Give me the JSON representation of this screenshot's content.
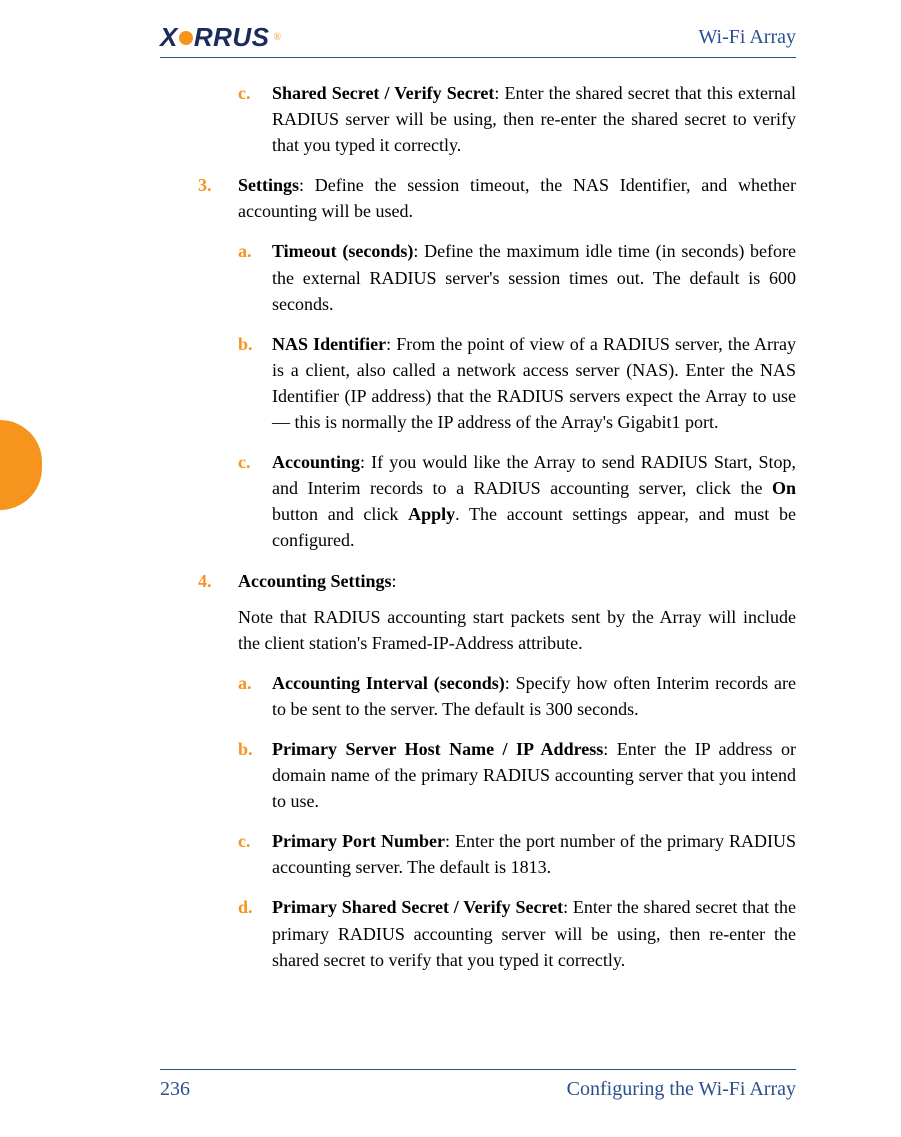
{
  "header": {
    "logo_text": "XIRRUS",
    "title": "Wi-Fi Array"
  },
  "content": {
    "item_c_top": {
      "marker": "c.",
      "lead": "Shared Secret / Verify Secret",
      "rest": ": Enter the shared secret that this external RADIUS server will be using, then re-enter the shared secret to verify that you typed it correctly."
    },
    "item_3": {
      "marker": "3.",
      "lead": "Settings",
      "rest": ": Define the session timeout, the NAS Identifier, and whether accounting will be used."
    },
    "item_3a": {
      "marker": "a.",
      "lead": "Timeout (seconds)",
      "rest": ": Define the maximum idle time (in seconds) before the external RADIUS server's session times out. The default is 600 seconds."
    },
    "item_3b": {
      "marker": "b.",
      "lead": "NAS Identifier",
      "rest": ": From the point of view of a RADIUS server, the Array is a client, also called a network access server (NAS). Enter the NAS Identifier (IP address) that the RADIUS servers expect the Array to use — this is normally the IP address of the Array's Gigabit1 port."
    },
    "item_3c": {
      "marker": "c.",
      "lead": "Accounting",
      "rest1": ": If you would like the Array to send RADIUS Start, Stop, and Interim records to a RADIUS accounting server, click the ",
      "bold1": "On",
      "rest2": " button and click ",
      "bold2": "Apply",
      "rest3": ". The account settings appear, and must be configured."
    },
    "item_4": {
      "marker": "4.",
      "lead": "Accounting Settings",
      "rest": ":",
      "note": "Note that RADIUS accounting start packets sent by the Array will include the client station's Framed-IP-Address attribute."
    },
    "item_4a": {
      "marker": "a.",
      "lead": "Accounting Interval (seconds)",
      "rest": ": Specify how often Interim records are to be sent to the server. The default is 300 seconds."
    },
    "item_4b": {
      "marker": "b.",
      "lead": "Primary Server Host Name / IP Address",
      "rest": ": Enter the IP address or domain name of the primary RADIUS accounting server that you intend to use."
    },
    "item_4c": {
      "marker": "c.",
      "lead": "Primary Port Number",
      "rest": ": Enter the port number of the primary RADIUS accounting server. The default is 1813."
    },
    "item_4d": {
      "marker": "d.",
      "lead": "Primary Shared Secret / Verify Secret",
      "rest": ": Enter the shared secret that the primary RADIUS accounting server will be using, then re-enter the shared secret to verify that you typed it correctly."
    }
  },
  "footer": {
    "page_number": "236",
    "section": "Configuring the Wi-Fi Array"
  }
}
